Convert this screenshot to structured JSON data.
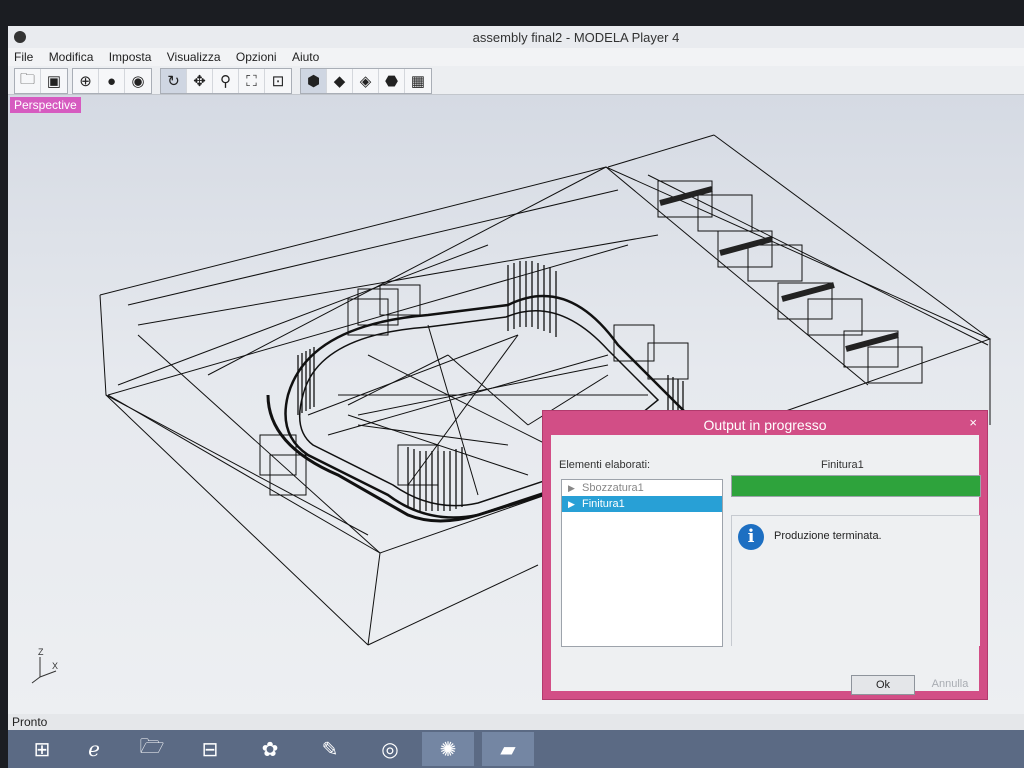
{
  "window": {
    "title": "assembly final2 - MODELA Player 4"
  },
  "menu": {
    "items": [
      "File",
      "Modifica",
      "Imposta",
      "Visualizza",
      "Opzioni",
      "Aiuto"
    ]
  },
  "toolbar": {
    "icons": [
      "open-folder-icon",
      "save-icon",
      "globe-icon",
      "sphere-icon",
      "sphere-dark-icon",
      "rotate-icon",
      "move-icon",
      "zoom-icon",
      "fit-icon",
      "fit-all-icon",
      "cube-solid-icon",
      "cube-front-icon",
      "cube-side-icon",
      "cube-top-icon",
      "grid-cube-icon"
    ]
  },
  "viewport": {
    "mode_label": "Perspective",
    "axis": {
      "z": "Z",
      "x": "X"
    }
  },
  "status": {
    "text": "Pronto"
  },
  "dialog": {
    "title": "Output in progresso",
    "close": "×",
    "elements_label": "Elementi elaborati:",
    "tree": [
      {
        "label": "Sbozzatura1",
        "selected": false
      },
      {
        "label": "Finitura1",
        "selected": true
      }
    ],
    "current_label": "Finitura1",
    "progress_fraction": 1.0,
    "progress_color": "#2ea33c",
    "message": "Produzione terminata.",
    "ok_label": "Ok",
    "cancel_label": "Annulla"
  },
  "taskbar": {
    "items": [
      "windows-start-icon",
      "internet-explorer-icon",
      "file-explorer-icon",
      "store-icon",
      "paint-icon",
      "notepad-icon",
      "chrome-icon",
      "settings-app-icon",
      "modela-player-icon"
    ]
  }
}
